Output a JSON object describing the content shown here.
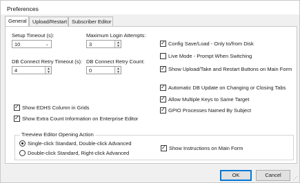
{
  "window": {
    "title": "Preferences"
  },
  "tabs": [
    {
      "label": "General",
      "active": true
    },
    {
      "label": "Upload/Restart",
      "active": false
    },
    {
      "label": "Subscriber Editor",
      "active": false
    }
  ],
  "left": {
    "setup_timeout": {
      "label": "Setup Timeout (s):",
      "value": "10"
    },
    "max_login": {
      "label": "Maximum Login Attempts:",
      "value": "3"
    },
    "db_retry_timeout": {
      "label": "DB Connect Retry Timeout (s):",
      "value": "4"
    },
    "db_retry_count": {
      "label": "DB Connect Retry Count:",
      "value": "0"
    },
    "show_edhs": {
      "label": "Show EDHS Column in Grids",
      "checked": true
    },
    "show_extra": {
      "label": "Show Extra Count Information on Enterprise Editor",
      "checked": true
    }
  },
  "right": {
    "config_save": {
      "label": "Config Save/Load - Only to/from Disk",
      "checked": true
    },
    "live_mode": {
      "label": "Live Mode - Prompt When Switching",
      "checked": false
    },
    "show_upload": {
      "label": "Show Upload/Take and Restart Buttons on Main Form",
      "checked": true
    },
    "auto_db": {
      "label": "Automatic DB Update on Changing or Closing Tabs",
      "checked": true
    },
    "multi_keys": {
      "label": "Allow Multiple Keys to Same Target",
      "checked": true
    },
    "gpio": {
      "label": "GPIO Processes Named By Subject",
      "checked": true
    }
  },
  "treeview": {
    "legend": "Treeview Editor Opening Action",
    "option1": {
      "label": "Single-click Standard, Double-click Advanced",
      "selected": true
    },
    "option2": {
      "label": "Double-click Standard, Right-click Advanced",
      "selected": false
    },
    "show_instructions": {
      "label": "Show Instructions on Main Form",
      "checked": true
    }
  },
  "buttons": {
    "ok": "OK",
    "cancel": "Cancel"
  },
  "colors": {
    "focus_border": "#0078d7",
    "panel_bg": "#ffffff",
    "window_bg": "#f0f0f0"
  }
}
